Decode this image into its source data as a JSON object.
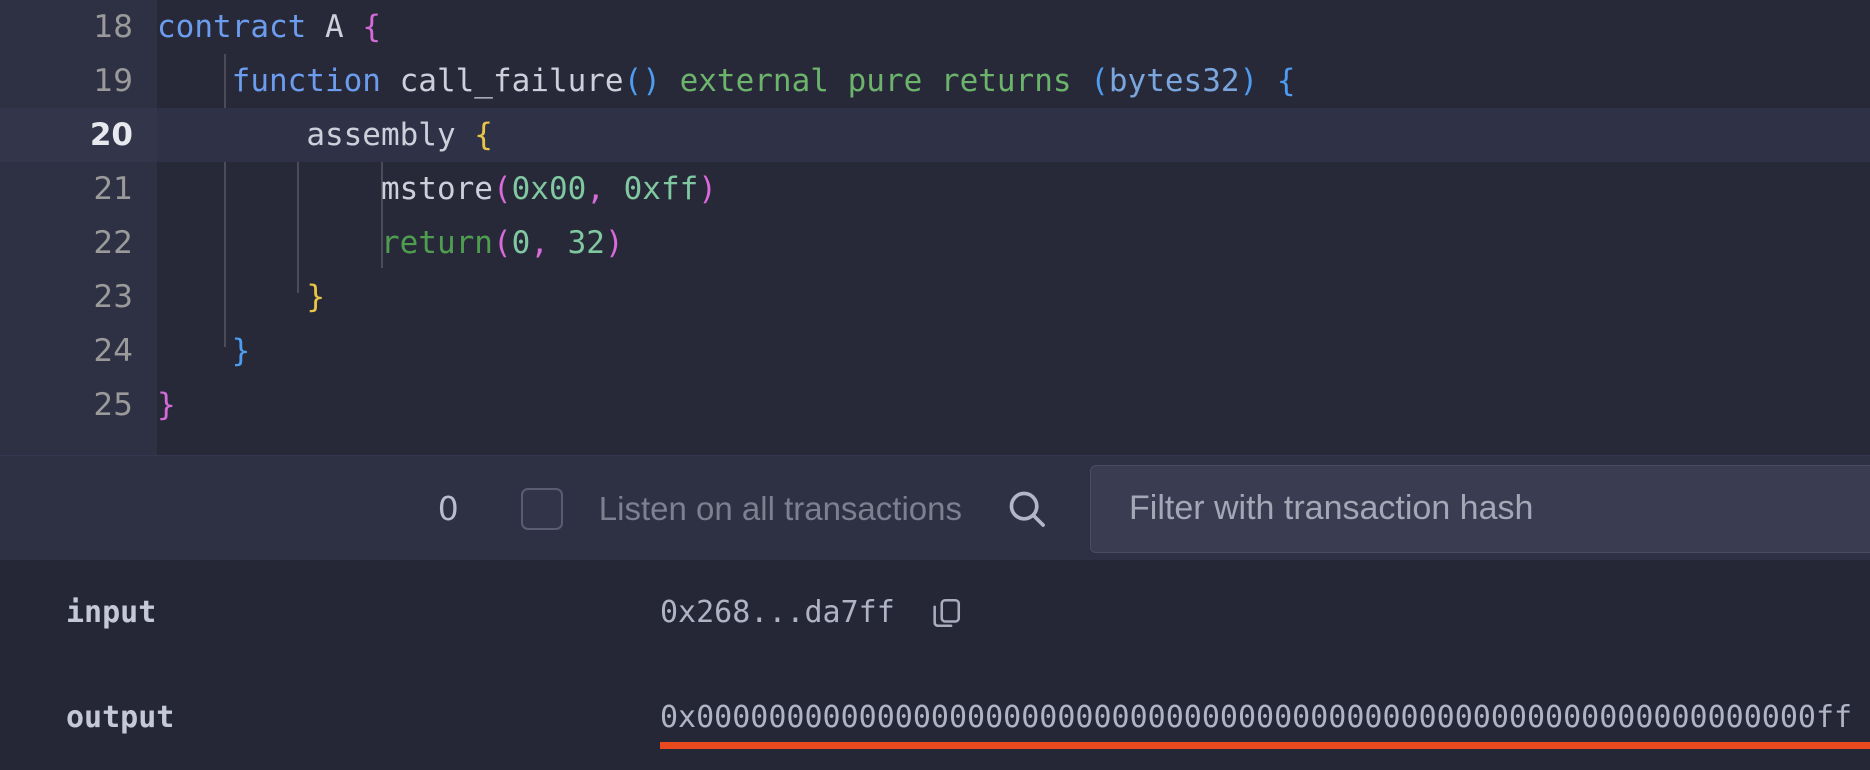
{
  "editor": {
    "lines": [
      {
        "number": "18",
        "active": false,
        "tokens": [
          {
            "t": "contract",
            "c": "tok-kw"
          },
          {
            "t": " A ",
            "c": "tok-plain"
          },
          {
            "t": "{",
            "c": "tok-brace-p"
          }
        ]
      },
      {
        "number": "19",
        "active": false,
        "tokens": [
          {
            "t": "    ",
            "c": "tok-plain"
          },
          {
            "t": "function",
            "c": "tok-kw"
          },
          {
            "t": " call_failure",
            "c": "tok-plain"
          },
          {
            "t": "()",
            "c": "tok-paren-b"
          },
          {
            "t": " ",
            "c": "tok-plain"
          },
          {
            "t": "external pure returns",
            "c": "tok-mod"
          },
          {
            "t": " ",
            "c": "tok-plain"
          },
          {
            "t": "(",
            "c": "tok-paren-b"
          },
          {
            "t": "bytes32",
            "c": "tok-type"
          },
          {
            "t": ")",
            "c": "tok-paren-b"
          },
          {
            "t": " ",
            "c": "tok-plain"
          },
          {
            "t": "{",
            "c": "tok-paren-b"
          }
        ]
      },
      {
        "number": "20",
        "active": true,
        "tokens": [
          {
            "t": "        ",
            "c": "tok-plain"
          },
          {
            "t": "assembly",
            "c": "tok-plain"
          },
          {
            "t": " ",
            "c": "tok-plain"
          },
          {
            "t": "{",
            "c": "tok-brace-y"
          }
        ]
      },
      {
        "number": "21",
        "active": false,
        "tokens": [
          {
            "t": "            ",
            "c": "tok-plain"
          },
          {
            "t": "mstore",
            "c": "tok-plain"
          },
          {
            "t": "(",
            "c": "tok-paren-m"
          },
          {
            "t": "0x00",
            "c": "tok-num"
          },
          {
            "t": ",",
            "c": "tok-paren-m"
          },
          {
            "t": " ",
            "c": "tok-plain"
          },
          {
            "t": "0xff",
            "c": "tok-num"
          },
          {
            "t": ")",
            "c": "tok-paren-m"
          }
        ]
      },
      {
        "number": "22",
        "active": false,
        "tokens": [
          {
            "t": "            ",
            "c": "tok-plain"
          },
          {
            "t": "return",
            "c": "tok-ret"
          },
          {
            "t": "(",
            "c": "tok-paren-m"
          },
          {
            "t": "0",
            "c": "tok-num"
          },
          {
            "t": ",",
            "c": "tok-paren-m"
          },
          {
            "t": " ",
            "c": "tok-plain"
          },
          {
            "t": "32",
            "c": "tok-num"
          },
          {
            "t": ")",
            "c": "tok-paren-m"
          }
        ]
      },
      {
        "number": "23",
        "active": false,
        "tokens": [
          {
            "t": "        ",
            "c": "tok-plain"
          },
          {
            "t": "}",
            "c": "tok-brace-y"
          }
        ]
      },
      {
        "number": "24",
        "active": false,
        "tokens": [
          {
            "t": "    ",
            "c": "tok-plain"
          },
          {
            "t": "}",
            "c": "tok-brace-b"
          }
        ]
      },
      {
        "number": "25",
        "active": false,
        "tokens": [
          {
            "t": "}",
            "c": "tok-brace-p"
          }
        ]
      }
    ]
  },
  "filter_bar": {
    "transaction_count": "0",
    "listen_label": "Listen on all transactions",
    "listen_checked": false,
    "search_icon": "search-icon",
    "filter_placeholder": "Filter with transaction hash"
  },
  "details": [
    {
      "key": "input",
      "value": "0x268...da7ff",
      "copy_icon": "copy-icon",
      "underlined": false
    },
    {
      "key": "output",
      "value": "0x00000000000000000000000000000000000000000000000000000000000000ff",
      "copy_icon": null,
      "underlined": true
    }
  ],
  "colors": {
    "editor_bg": "#272939",
    "gutter_bg": "#2e3044",
    "active_line_bg": "#2f3147",
    "panel_bg": "#252737",
    "filter_bar_bg": "#2e3044",
    "underline_red": "#e8491f",
    "keyword_blue": "#6c9ced",
    "modifier_green": "#6cb36b",
    "number_green": "#7fc8a0",
    "brace_yellow": "#e8c547",
    "brace_magenta": "#d46ad6"
  }
}
